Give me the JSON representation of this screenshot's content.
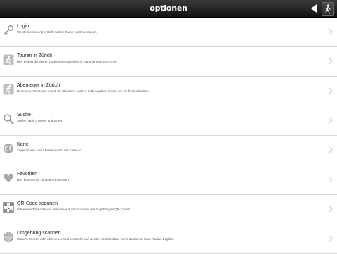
{
  "header": {
    "title": "optionen"
  },
  "items": [
    {
      "title": "Login",
      "desc": "Werde kreativ und erstelle selbst Touren und Abenteuer.",
      "icon": "key-icon"
    },
    {
      "title": "Touren in Zürich",
      "desc": "Hier findest du Touren und themenspezifische Sammlungen von Orten.",
      "icon": "walking-person-icon"
    },
    {
      "title": "Abenteuer in Zürich",
      "desc": "Bei einem Abenteuer musst du Stationen suchen und Aufgaben lösen, um sie freizuschalten.",
      "icon": "running-person-icon"
    },
    {
      "title": "Suche",
      "desc": "Suche nach Themen und Orten.",
      "icon": "magnifier-icon"
    },
    {
      "title": "Karte",
      "desc": "Zeige Touren und Abenteuer auf der Karte an.",
      "icon": "globe-icon"
    },
    {
      "title": "Favoriten",
      "desc": "Hier kommst du zu deinen Favoriten.",
      "icon": "heart-icon"
    },
    {
      "title": "QR-Code scannen",
      "desc": "Öffne eine Tour oder ein Abenteuer durch scannen des zugehörigen QR-Codes.",
      "icon": "qr-code-icon"
    },
    {
      "title": "Umgebung scannen",
      "desc": "Manche Touren oder Abenteuer sind versteckt und werden erst sichtbar, wenn du dich in ihren Radius begibst.",
      "icon": "radar-icon"
    }
  ]
}
